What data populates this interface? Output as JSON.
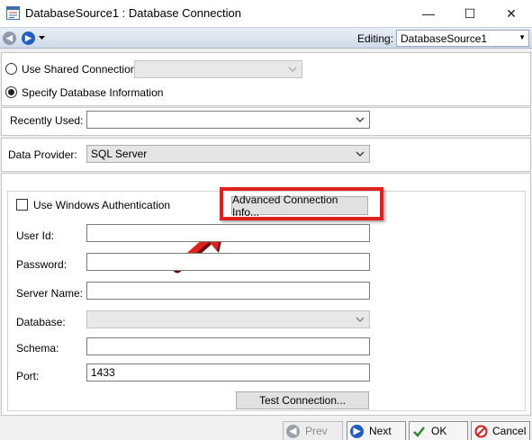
{
  "window": {
    "title": "DatabaseSource1 : Database Connection",
    "minimize_glyph": "—",
    "maximize_glyph": "☐",
    "close_glyph": "✕"
  },
  "toolbar": {
    "editing_label": "Editing:",
    "editing_value": "DatabaseSource1"
  },
  "connection_mode": {
    "shared_label": "Use Shared Connection",
    "specify_label": "Specify Database Information",
    "selected": "specify"
  },
  "recently_used": {
    "label": "Recently Used:",
    "value": ""
  },
  "data_provider": {
    "label": "Data Provider:",
    "value": "SQL Server"
  },
  "auth": {
    "windows_auth_label": "Use Windows Authentication",
    "windows_auth_checked": false,
    "advanced_button": "Advanced Connection Info..."
  },
  "fields": {
    "user_id": {
      "label": "User Id:",
      "value": ""
    },
    "password": {
      "label": "Password:",
      "value": ""
    },
    "server_name": {
      "label": "Server Name:",
      "value": ""
    },
    "database": {
      "label": "Database:",
      "value": ""
    },
    "schema": {
      "label": "Schema:",
      "value": ""
    },
    "port": {
      "label": "Port:",
      "value": "1433"
    }
  },
  "test_button": "Test Connection...",
  "footer": {
    "prev": "Prev",
    "next": "Next",
    "ok": "OK",
    "cancel": "Cancel"
  },
  "colors": {
    "highlight_red": "#e0201c",
    "nav_blue": "#1f5fbf",
    "ok_green": "#2e8b2e",
    "cancel_red": "#d11f1f"
  },
  "icons": {
    "app": "app-window-icon",
    "back": "back-arrow-icon",
    "forward": "forward-arrow-icon",
    "annotation": "red-arrow-annotation-icon"
  }
}
